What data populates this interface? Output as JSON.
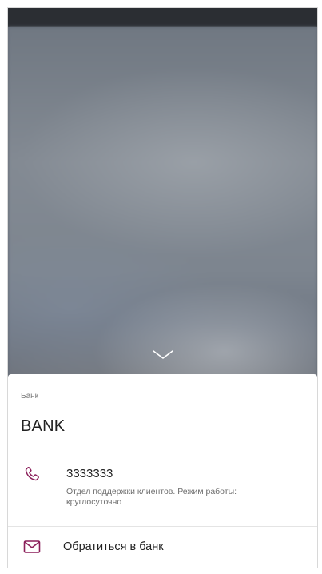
{
  "colors": {
    "accent": "#8b1f5a",
    "status_bar": "#2b2e33",
    "sheet_bg": "#ffffff",
    "primary_text": "#222222",
    "secondary_text": "#6e6e6e"
  },
  "icons": {
    "collapse": "chevron-down-icon",
    "phone": "phone-icon",
    "mail": "mail-icon"
  },
  "sheet": {
    "caption": "Банк",
    "title": "BANK",
    "phone": {
      "number": "3333333",
      "note": "Отдел поддержки клиентов. Режим работы: круглосуточно"
    },
    "contact": {
      "label": "Обратиться в банк"
    }
  }
}
